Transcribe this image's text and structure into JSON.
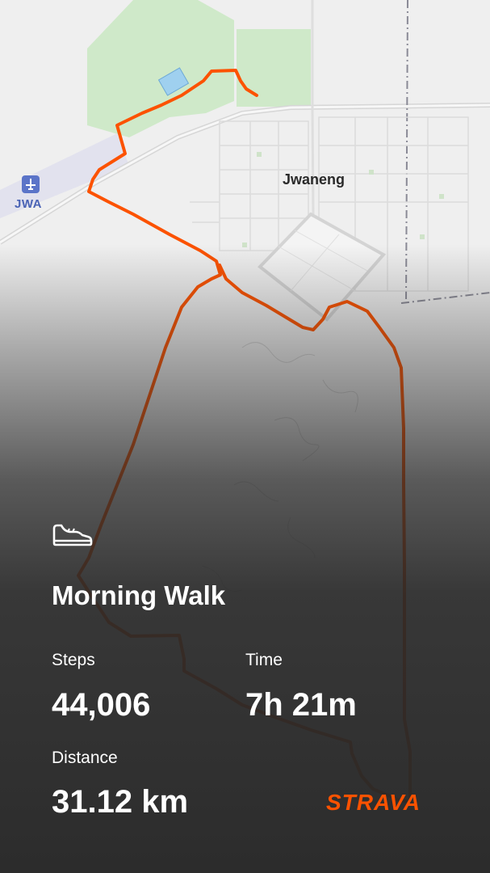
{
  "map": {
    "airport_code": "JWA",
    "town_name": "Jwaneng",
    "route_color": "#fc5200"
  },
  "activity": {
    "icon": "shoe-icon",
    "title": "Morning Walk",
    "stats": {
      "steps_label": "Steps",
      "steps_value": "44,006",
      "time_label": "Time",
      "time_value": "7h 21m",
      "distance_label": "Distance",
      "distance_value": "31.12 km"
    }
  },
  "brand": {
    "name": "STRAVA",
    "color": "#fc5200"
  }
}
